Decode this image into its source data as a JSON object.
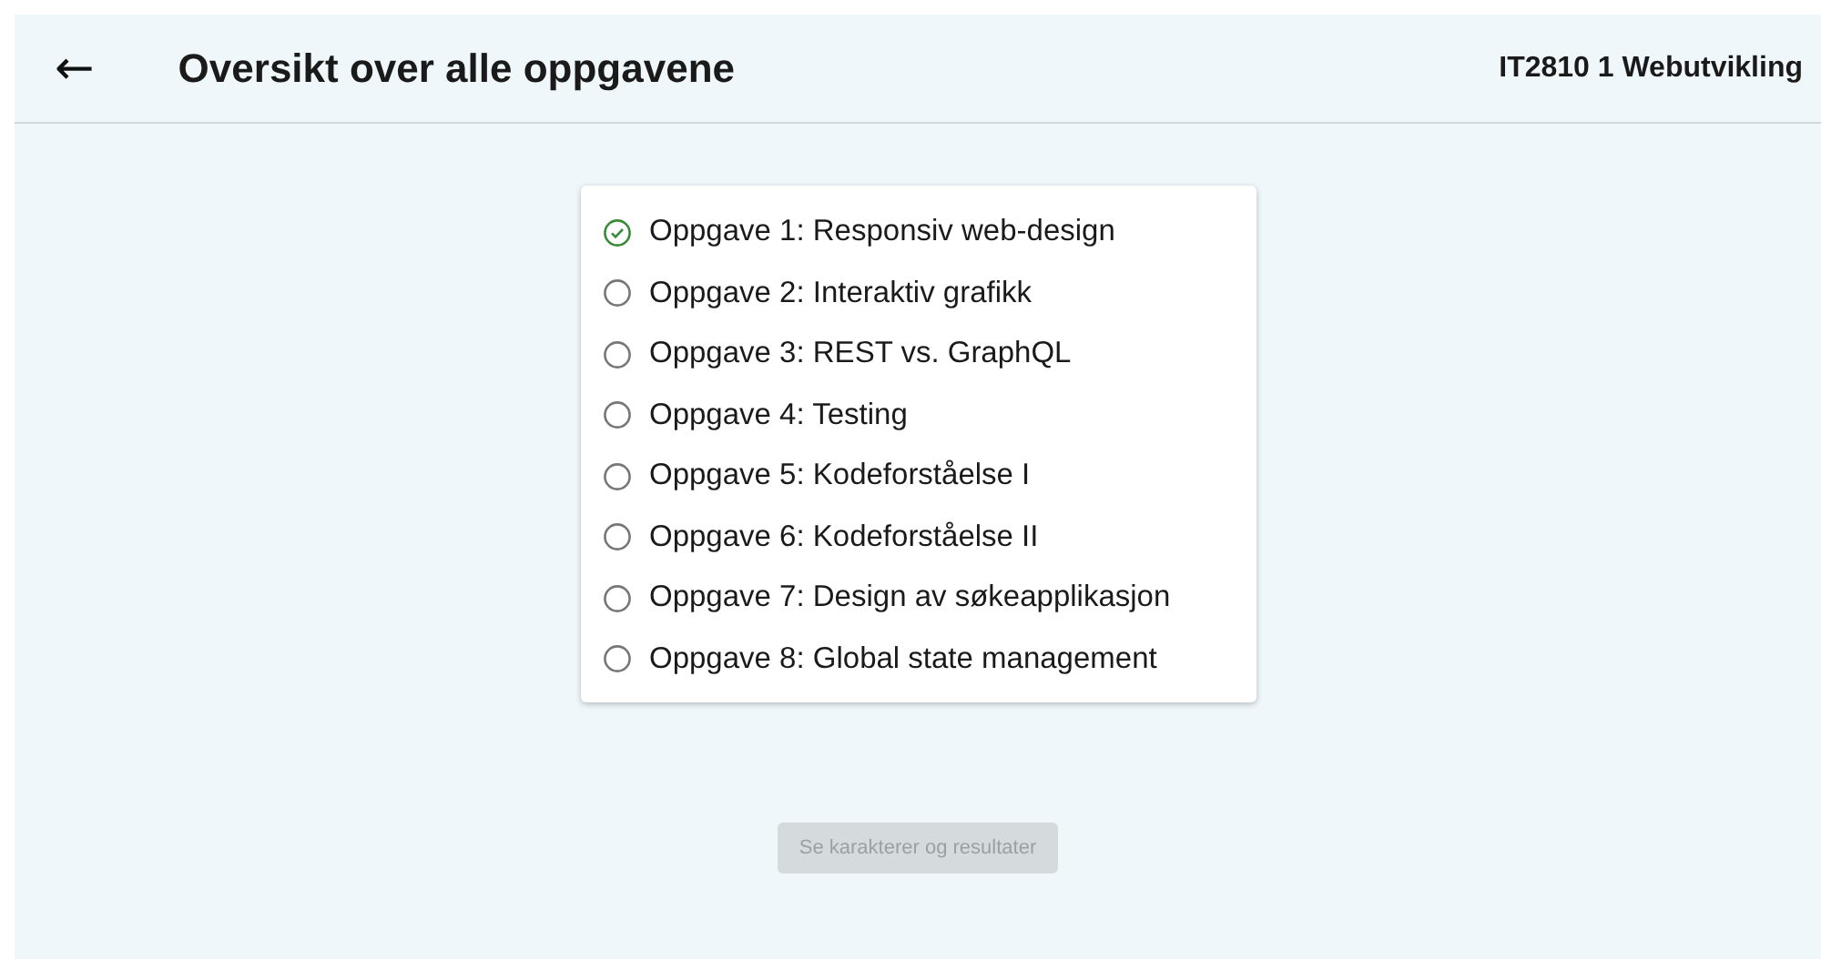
{
  "header": {
    "back_icon": "←",
    "title": "Oversikt over alle oppgavene",
    "course": "IT2810 1 Webutvikling"
  },
  "tasks": [
    {
      "label": "Oppgave 1: Responsiv web-design",
      "completed": true
    },
    {
      "label": "Oppgave 2: Interaktiv grafikk",
      "completed": false
    },
    {
      "label": "Oppgave 3: REST vs. GraphQL",
      "completed": false
    },
    {
      "label": "Oppgave 4: Testing",
      "completed": false
    },
    {
      "label": "Oppgave 5: Kodeforståelse I",
      "completed": false
    },
    {
      "label": "Oppgave 6: Kodeforståelse II",
      "completed": false
    },
    {
      "label": "Oppgave 7: Design av søkeapplikasjon",
      "completed": false
    },
    {
      "label": "Oppgave 8: Global state management",
      "completed": false
    }
  ],
  "results_button": {
    "label": "Se karakterer og resultater",
    "disabled": true
  }
}
